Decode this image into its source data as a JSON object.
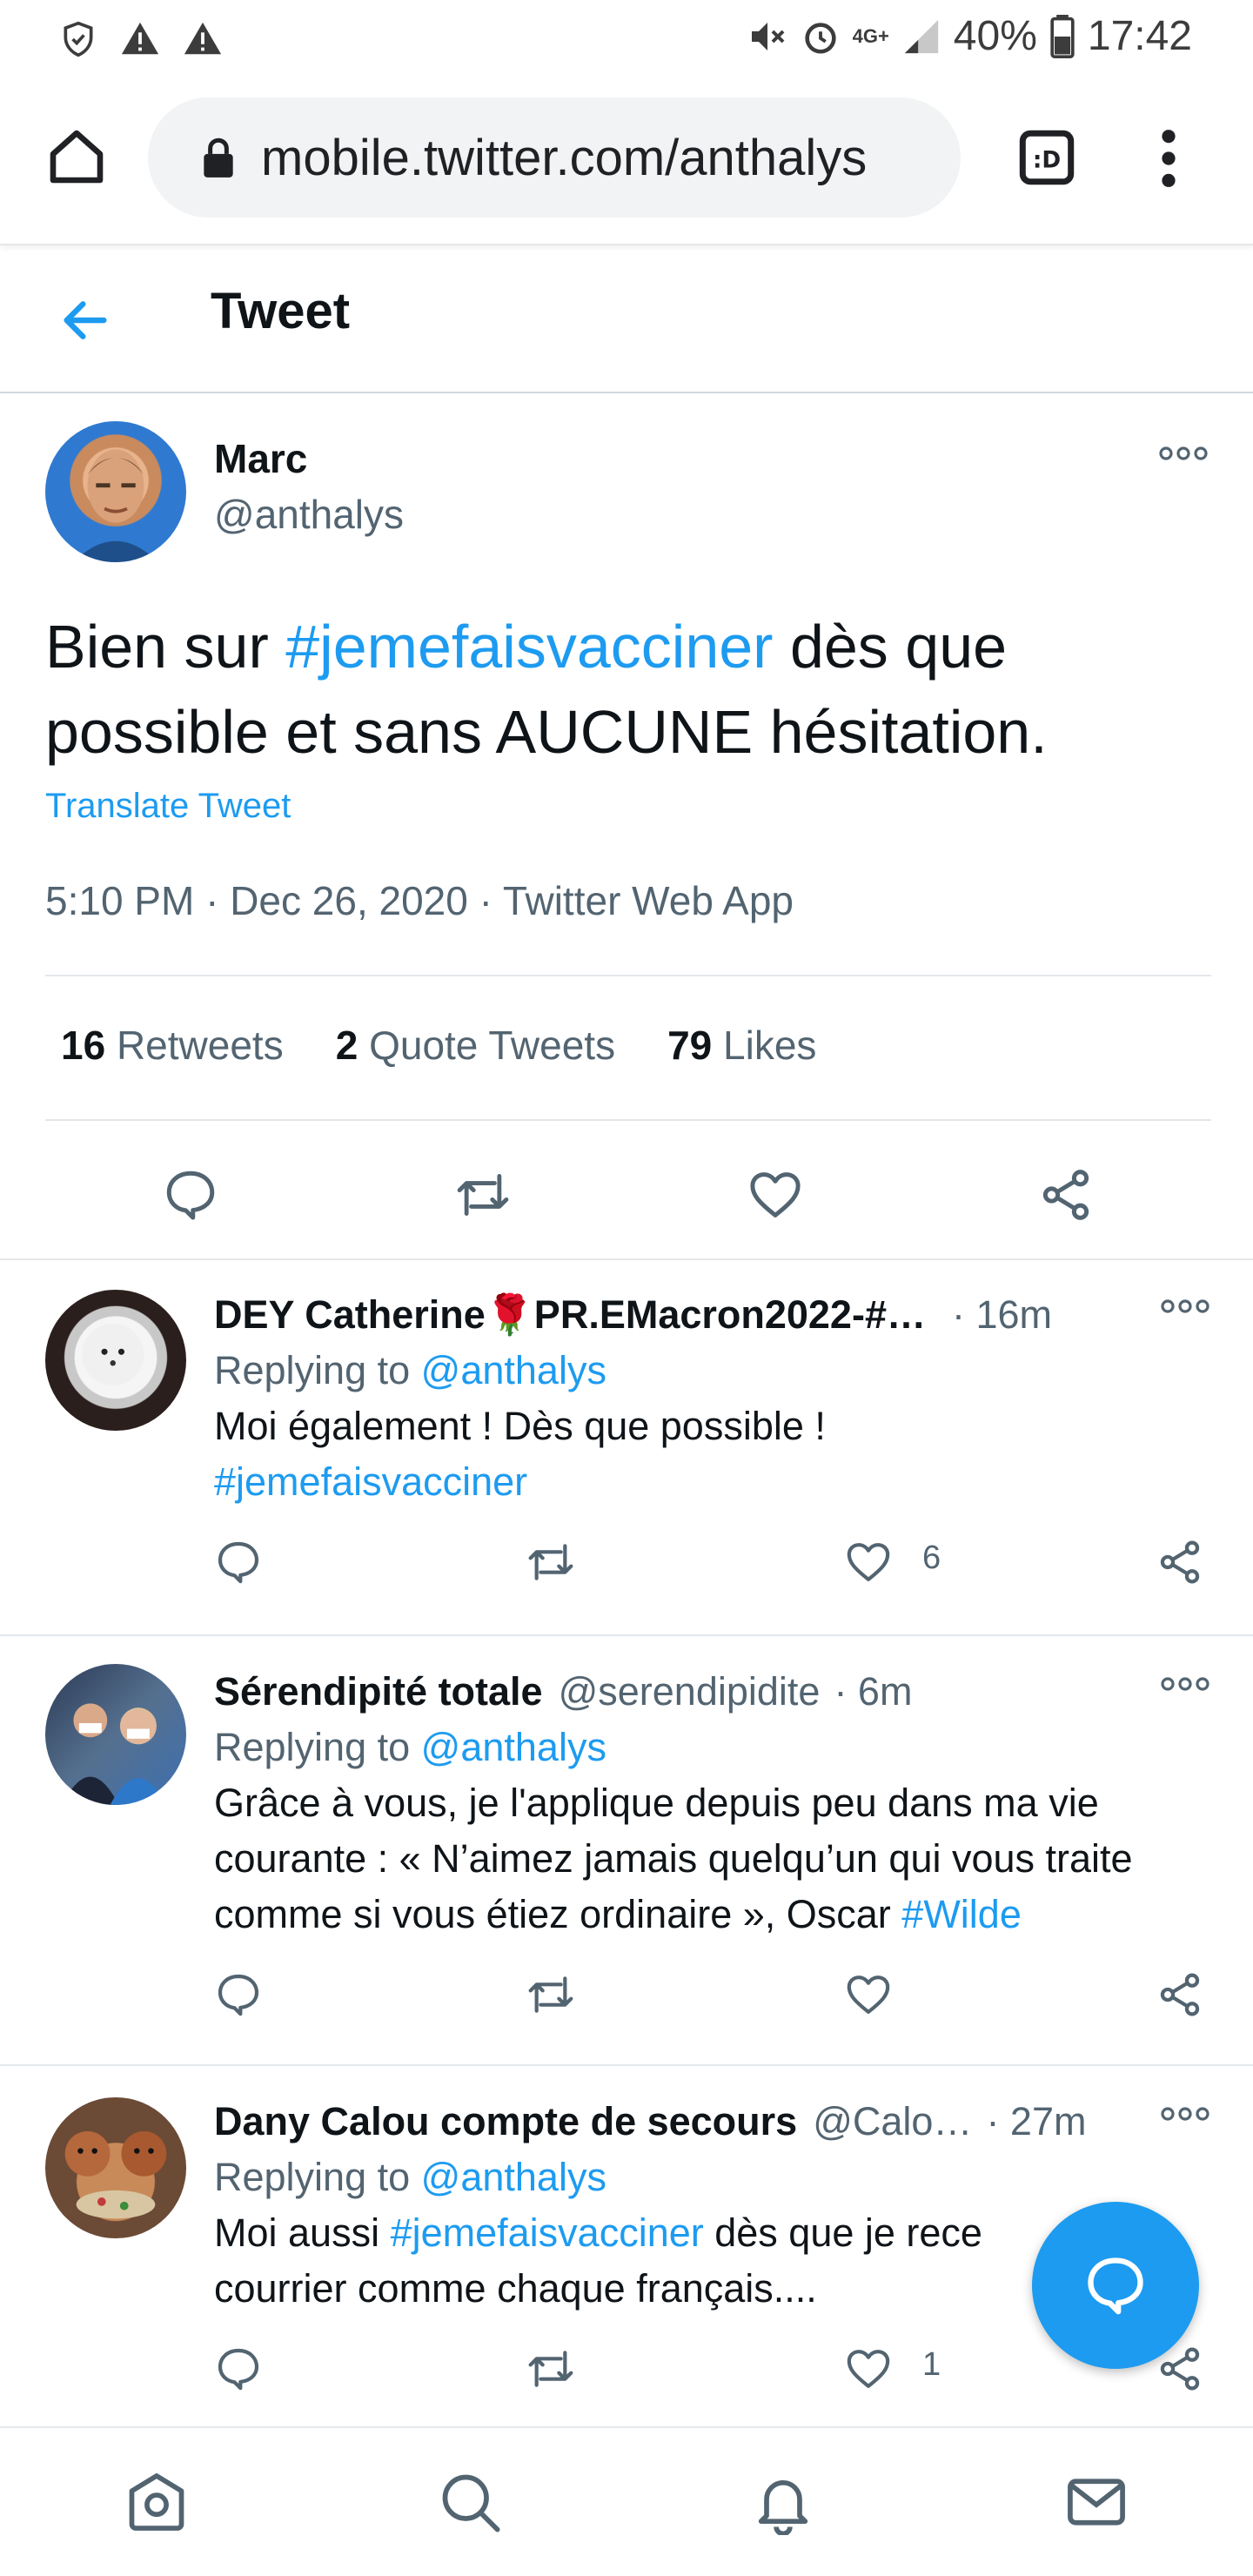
{
  "status_bar": {
    "battery": "40%",
    "time": "17:42",
    "network": "4G+"
  },
  "browser": {
    "url": "mobile.twitter.com/anthalys"
  },
  "header": {
    "title": "Tweet"
  },
  "main_tweet": {
    "name": "Marc",
    "handle": "@anthalys",
    "text_before": "Bien sur ",
    "hashtag": "#jemefaisvacciner",
    "text_after": " dès que possible et sans AUCUNE hésitation.",
    "translate": "Translate Tweet",
    "time": "5:10 PM",
    "date": "Dec 26, 2020",
    "source": "Twitter Web App",
    "retweets_count": "16",
    "retweets_label": "Retweets",
    "quotes_count": "2",
    "quotes_label": "Quote Tweets",
    "likes_count": "79",
    "likes_label": "Likes"
  },
  "replies": [
    {
      "name": "DEY Catherine🌹PR.EMacron2022-#…",
      "handle": "",
      "time": "· 16m",
      "replying_prefix": "Replying to",
      "replying_to": "@anthalys",
      "text": "Moi également ! Dès que possible !",
      "hashtag": "#jemefaisvacciner",
      "likes": "6"
    },
    {
      "name": "Sérendipité totale",
      "handle": "@serendipidite",
      "time": "· 6m",
      "replying_prefix": "Replying to",
      "replying_to": "@anthalys",
      "text": "Grâce à vous, je l'applique depuis peu dans ma vie courante : « N’aimez jamais quelqu’un qui vous traite comme si vous étiez ordinaire », Oscar ",
      "hashtag": "#Wilde",
      "likes": ""
    },
    {
      "name": "Dany Calou compte de secours",
      "handle": "@Calo…",
      "time": "· 27m",
      "replying_prefix": "Replying to",
      "replying_to": "@anthalys",
      "text_before": "Moi aussi ",
      "hashtag": "#jemefaisvacciner",
      "text_after": " dès que je rece",
      "text_line2": "courrier comme chaque français....",
      "likes": "1"
    }
  ],
  "colors": {
    "accent": "#1d9bf0",
    "text": "#0f1419",
    "secondary": "#536471"
  }
}
